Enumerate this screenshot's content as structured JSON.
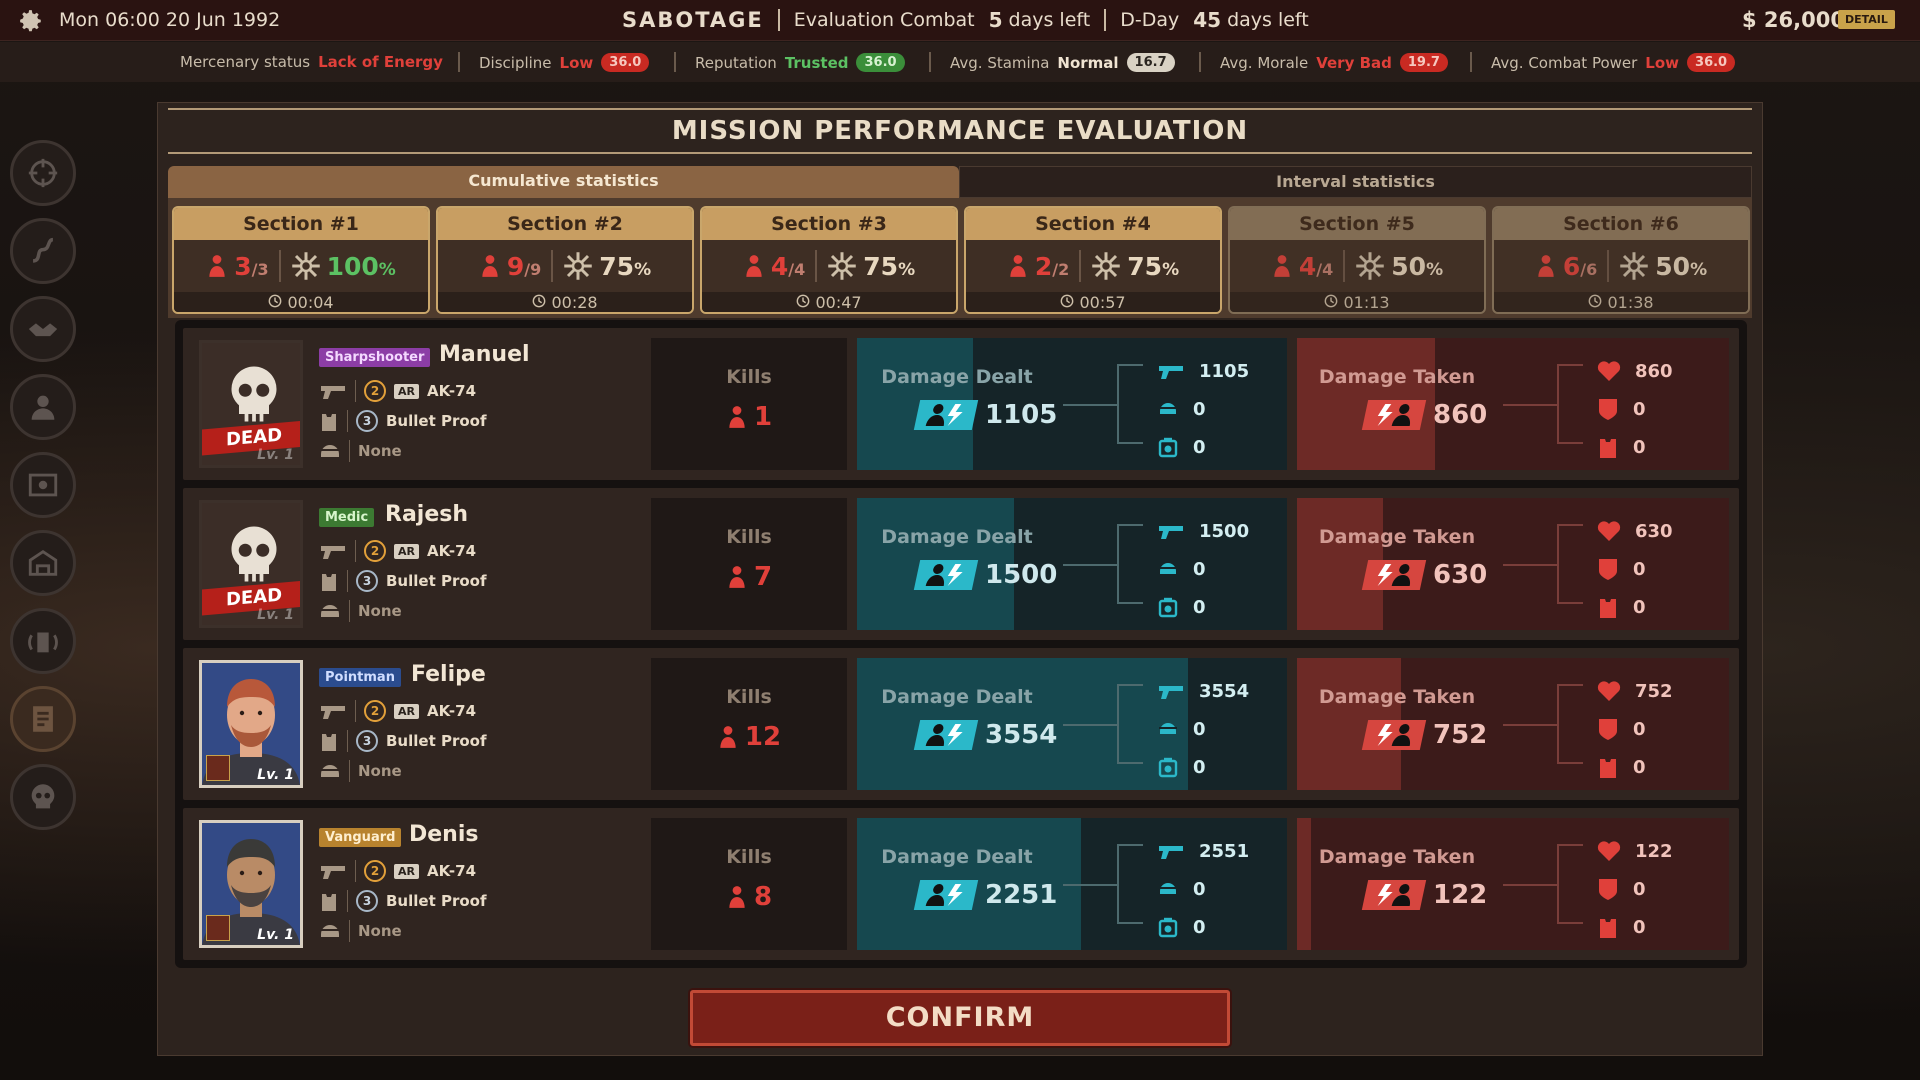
{
  "topbar": {
    "date": "Mon 06:00   20 Jun 1992",
    "operation": "SABOTAGE",
    "eval_label": "Evaluation Combat",
    "eval_days": "5",
    "eval_suffix": "days left",
    "dday_label": "D-Day",
    "dday_days": "45",
    "dday_suffix": "days left",
    "money": "$ 26,000",
    "detail": "DETAIL"
  },
  "status": {
    "merc_label": "Mercenary status",
    "merc_value": "Lack of Energy",
    "discipline_label": "Discipline",
    "discipline_value": "Low",
    "discipline_num": "36.0",
    "reputation_label": "Reputation",
    "reputation_value": "Trusted",
    "reputation_num": "36.0",
    "stamina_label": "Avg. Stamina",
    "stamina_value": "Normal",
    "stamina_num": "16.7",
    "morale_label": "Avg. Morale",
    "morale_value": "Very Bad",
    "morale_num": "19.7",
    "power_label": "Avg. Combat Power",
    "power_value": "Low",
    "power_num": "36.0"
  },
  "nav_icons": [
    "crosshair-icon",
    "route-icon",
    "handshake-icon",
    "soldier-icon",
    "intel-icon",
    "hangar-icon",
    "radio-icon",
    "file-icon",
    "skull-icon"
  ],
  "title": "MISSION PERFORMANCE EVALUATION",
  "tabs": [
    "Cumulative statistics",
    "Interval statistics"
  ],
  "sections": [
    {
      "label": "Section #1",
      "kills": "3",
      "total": "/3",
      "pct": "100",
      "time": "00:04"
    },
    {
      "label": "Section #2",
      "kills": "9",
      "total": "/9",
      "pct": "75",
      "time": "00:28"
    },
    {
      "label": "Section #3",
      "kills": "4",
      "total": "/4",
      "pct": "75",
      "time": "00:47"
    },
    {
      "label": "Section #4",
      "kills": "2",
      "total": "/2",
      "pct": "75",
      "time": "00:57"
    },
    {
      "label": "Section #5",
      "kills": "4",
      "total": "/4",
      "pct": "50",
      "time": "01:13"
    },
    {
      "label": "Section #6",
      "kills": "6",
      "total": "/6",
      "pct": "50",
      "time": "01:38"
    }
  ],
  "pct_sign": "%",
  "labels": {
    "kills": "Kills",
    "dealt": "Damage Dealt",
    "taken": "Damage Taken",
    "dead": "DEAD",
    "confirm": "CONFIRM"
  },
  "mercs": [
    {
      "role": "Sharpshooter",
      "name": "Manuel",
      "weapon_lvl": "2",
      "weapon_type": "AR",
      "weapon": "AK-74",
      "armor_lvl": "3",
      "armor": "Bullet Proof",
      "helmet": "None",
      "level": "Lv. 1",
      "status": "DEAD",
      "kills": "1",
      "dealt": "1105",
      "dealt_weapon": "1105",
      "dealt_grenade": "0",
      "dealt_other": "0",
      "taken": "860",
      "taken_hp": "860",
      "taken_armor": "0",
      "taken_vest": "0",
      "dealt_ratio": 0.27,
      "taken_ratio": 0.32
    },
    {
      "role": "Medic",
      "name": "Rajesh",
      "weapon_lvl": "2",
      "weapon_type": "AR",
      "weapon": "AK-74",
      "armor_lvl": "3",
      "armor": "Bullet Proof",
      "helmet": "None",
      "level": "Lv. 1",
      "status": "DEAD",
      "kills": "7",
      "dealt": "1500",
      "dealt_weapon": "1500",
      "dealt_grenade": "0",
      "dealt_other": "0",
      "taken": "630",
      "taken_hp": "630",
      "taken_armor": "0",
      "taken_vest": "0",
      "dealt_ratio": 0.365,
      "taken_ratio": 0.2
    },
    {
      "role": "Pointman",
      "name": "Felipe",
      "weapon_lvl": "2",
      "weapon_type": "AR",
      "weapon": "AK-74",
      "armor_lvl": "3",
      "armor": "Bullet Proof",
      "helmet": "None",
      "level": "Lv. 1",
      "status": "",
      "kills": "12",
      "dealt": "3554",
      "dealt_weapon": "3554",
      "dealt_grenade": "0",
      "dealt_other": "0",
      "taken": "752",
      "taken_hp": "752",
      "taken_armor": "0",
      "taken_vest": "0",
      "dealt_ratio": 0.77,
      "taken_ratio": 0.24
    },
    {
      "role": "Vanguard",
      "name": "Denis",
      "weapon_lvl": "2",
      "weapon_type": "AR",
      "weapon": "AK-74",
      "armor_lvl": "3",
      "armor": "Bullet Proof",
      "helmet": "None",
      "level": "Lv. 1",
      "status": "",
      "kills": "8",
      "dealt": "2251",
      "dealt_weapon": "2551",
      "dealt_grenade": "0",
      "dealt_other": "0",
      "taken": "122",
      "taken_hp": "122",
      "taken_armor": "0",
      "taken_vest": "0",
      "dealt_ratio": 0.52,
      "taken_ratio": 0.03
    }
  ],
  "colors": {
    "accent": "#c89e62",
    "kill_red": "#e0403a",
    "dealt_cyan": "#2bb8c9",
    "taken_red": "#d6463f",
    "good_green": "#5cc163"
  }
}
